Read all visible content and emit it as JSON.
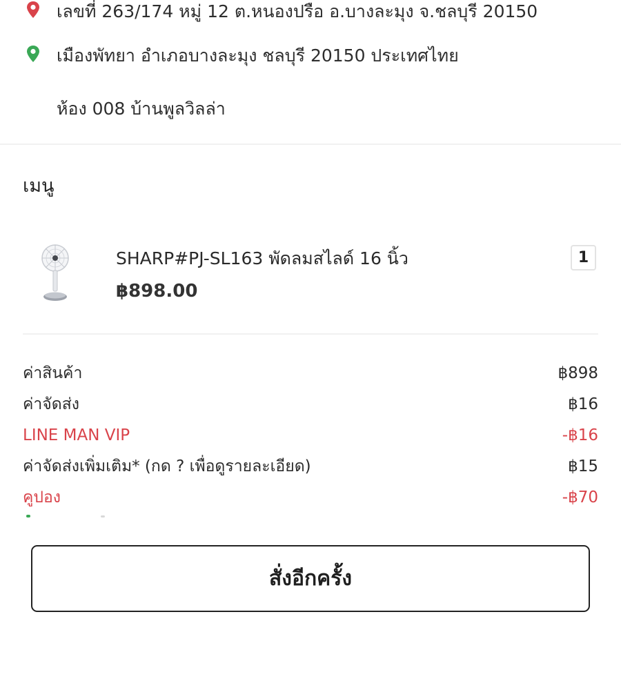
{
  "address": {
    "lines": [
      {
        "icon": "red-location-pin-icon",
        "text": "เลขที่ 263/174 หมู่ 12 ต.หนองปรือ อ.บางละมุง จ.ชลบุรี 20150"
      },
      {
        "icon": "green-location-pin-icon",
        "text": "เมืองพัทยา อำเภอบางละมุง ชลบุรี 20150 ประเทศไทย"
      },
      {
        "icon": "",
        "text": "ห้อง 008 บ้านพูลวิลล่า"
      }
    ],
    "colors": {
      "red_pin": "#d9434a",
      "green_pin": "#3aa856"
    }
  },
  "menu": {
    "title": "เมนู",
    "items": [
      {
        "name": "SHARP#PJ-SL163 พัดลมสไลด์ 16 นิ้ว",
        "price": "฿898.00",
        "quantity": "1",
        "image": "standing-fan-image"
      }
    ]
  },
  "summary": {
    "rows": [
      {
        "label": "ค่าสินค้า",
        "value": "฿898",
        "color": "#2b2b2b"
      },
      {
        "label": "ค่าจัดส่ง",
        "value": "฿16",
        "color": "#2b2b2b"
      },
      {
        "label": "LINE MAN VIP",
        "value": "-฿16",
        "color": "#d9434a"
      },
      {
        "label": "ค่าจัดส่งเพิ่มเติม* (กด ? เพื่อดูรายละเอียด)",
        "value": "฿15",
        "color": "#2b2b2b"
      },
      {
        "label": "คูปอง",
        "value": "-฿70",
        "color": "#d9434a"
      }
    ]
  },
  "actions": {
    "reorder_label": "สั่งอีกครั้ง"
  }
}
